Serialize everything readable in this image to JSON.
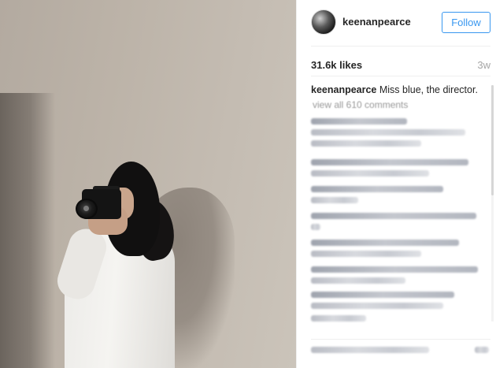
{
  "post": {
    "username": "keenanpearce",
    "follow_label": "Follow",
    "likes": "31.6k likes",
    "age": "3w",
    "caption_user": "keenanpearce",
    "caption_text": " Miss blue, the director.",
    "view_all_comments": "view all 610 comments"
  },
  "colors": {
    "accent": "#3897f0",
    "text": "#262626",
    "muted": "#a5a5a5"
  },
  "icons": {
    "avatar": "profile-photo",
    "photo": "woman-with-camera-photo"
  }
}
